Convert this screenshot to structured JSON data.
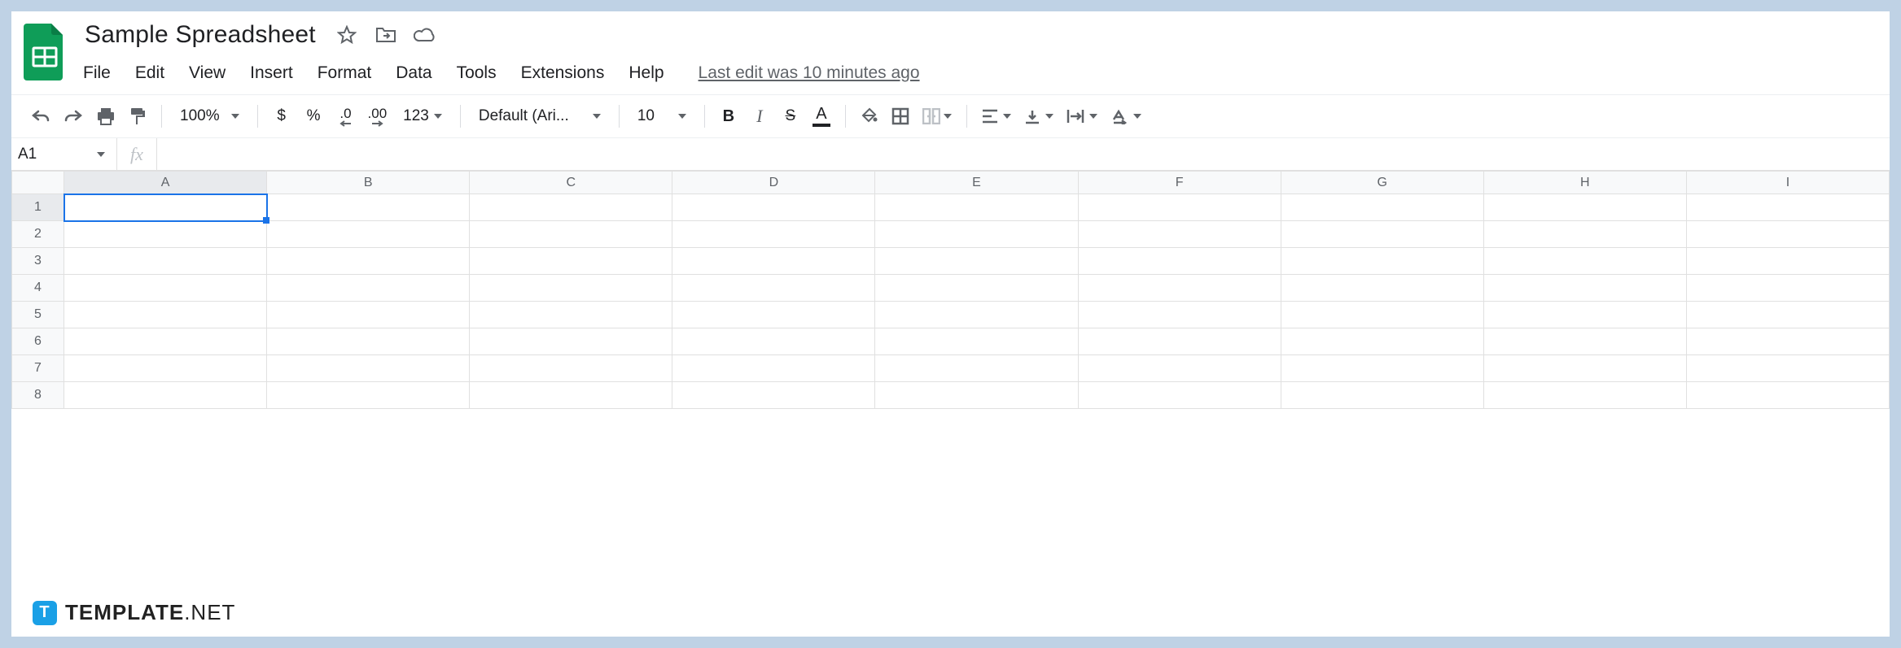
{
  "header": {
    "title": "Sample Spreadsheet",
    "last_edit": "Last edit was 10 minutes ago"
  },
  "menu": {
    "file": "File",
    "edit": "Edit",
    "view": "View",
    "insert": "Insert",
    "format": "Format",
    "data": "Data",
    "tools": "Tools",
    "extensions": "Extensions",
    "help": "Help"
  },
  "toolbar": {
    "zoom": "100%",
    "currency": "$",
    "percent": "%",
    "dec_decrease": ".0",
    "dec_increase": ".00",
    "number_format": "123",
    "font": "Default (Ari...",
    "font_size": "10",
    "bold": "B",
    "italic": "I",
    "strike": "S",
    "text_color": "A"
  },
  "fxbar": {
    "name_box": "A1",
    "fx_label": "fx",
    "formula": ""
  },
  "sheet": {
    "columns": [
      "A",
      "B",
      "C",
      "D",
      "E",
      "F",
      "G",
      "H",
      "I"
    ],
    "rows": [
      1,
      2,
      3,
      4,
      5,
      6,
      7,
      8
    ],
    "active_col": "A",
    "active_row": 1
  },
  "watermark": {
    "badge": "T",
    "bold": "TEMPLATE",
    "thin": ".NET"
  }
}
